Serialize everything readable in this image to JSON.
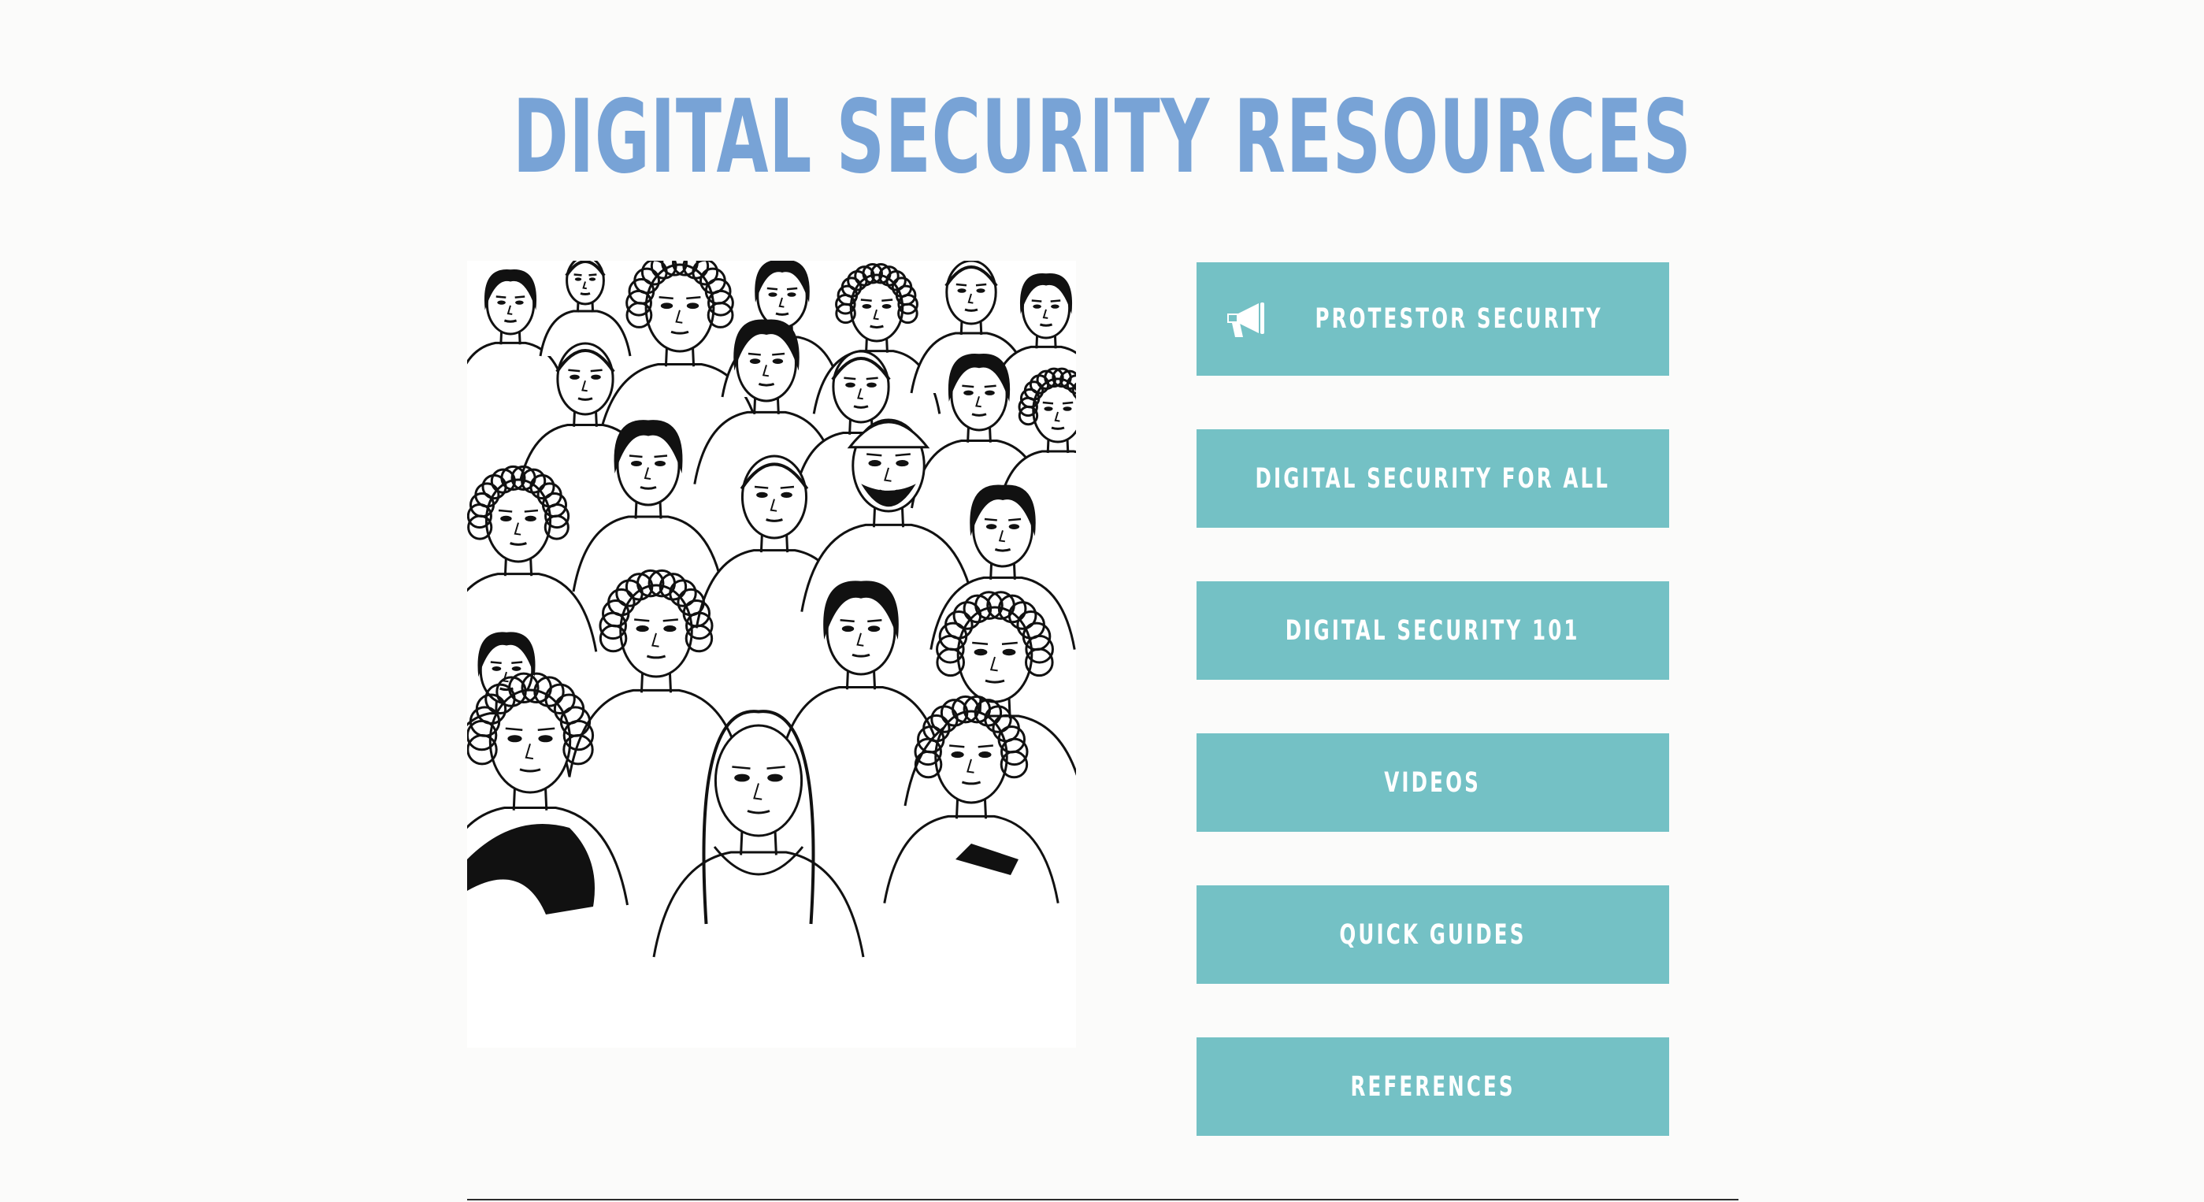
{
  "page": {
    "title": "DIGITAL SECURITY RESOURCES"
  },
  "illustration": {
    "description_icon": "crowd-illustration"
  },
  "buttons": [
    {
      "label": "PROTESTOR SECURITY",
      "icon": "megaphone-icon"
    },
    {
      "label": "DIGITAL SECURITY FOR ALL"
    },
    {
      "label": "DIGITAL SECURITY 101"
    },
    {
      "label": "VIDEOS"
    },
    {
      "label": "QUICK GUIDES"
    },
    {
      "label": "REFERENCES"
    }
  ],
  "colors": {
    "background": "#fbfbfa",
    "title": "#78a3d6",
    "button": "#74c1c5",
    "button_text": "#ffffff",
    "rule": "#2c2c2c"
  }
}
